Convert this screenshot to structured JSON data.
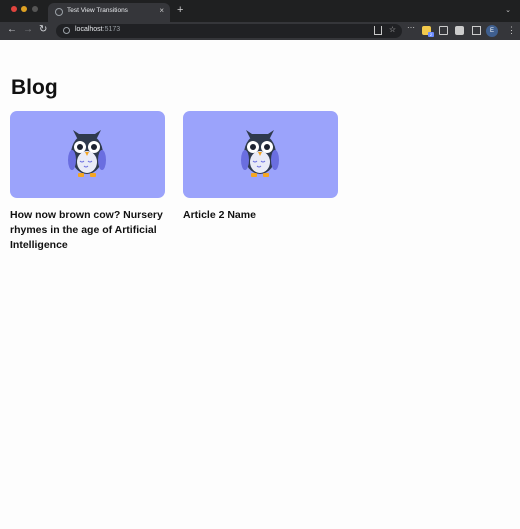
{
  "browser": {
    "tab_title": "Test View Transitions",
    "tab_close": "×",
    "new_tab": "+",
    "url_host": "localhost",
    "url_port": ":5173",
    "profile_initial": "E",
    "extension_badge": "2",
    "icons": {
      "back": "arrow-left-icon",
      "forward": "arrow-right-icon",
      "reload": "reload-icon",
      "site_info": "info-icon",
      "share": "share-icon",
      "bookmark": "star-icon",
      "extensions": "puzzle-icon",
      "side_panel": "side-panel-icon",
      "menu": "kebab-menu-icon"
    }
  },
  "page": {
    "heading": "Blog",
    "articles": [
      {
        "title": "How now brown cow? Nursery rhymes in the age of Artificial Intelligence",
        "image": "owl-illustration"
      },
      {
        "title": "Article 2 Name",
        "image": "owl-illustration"
      }
    ]
  },
  "colors": {
    "card_background": "#9ba3fb",
    "owl_body": "#2f3a4d",
    "owl_wing": "#6a6ee0",
    "owl_feet": "#f5a623"
  }
}
